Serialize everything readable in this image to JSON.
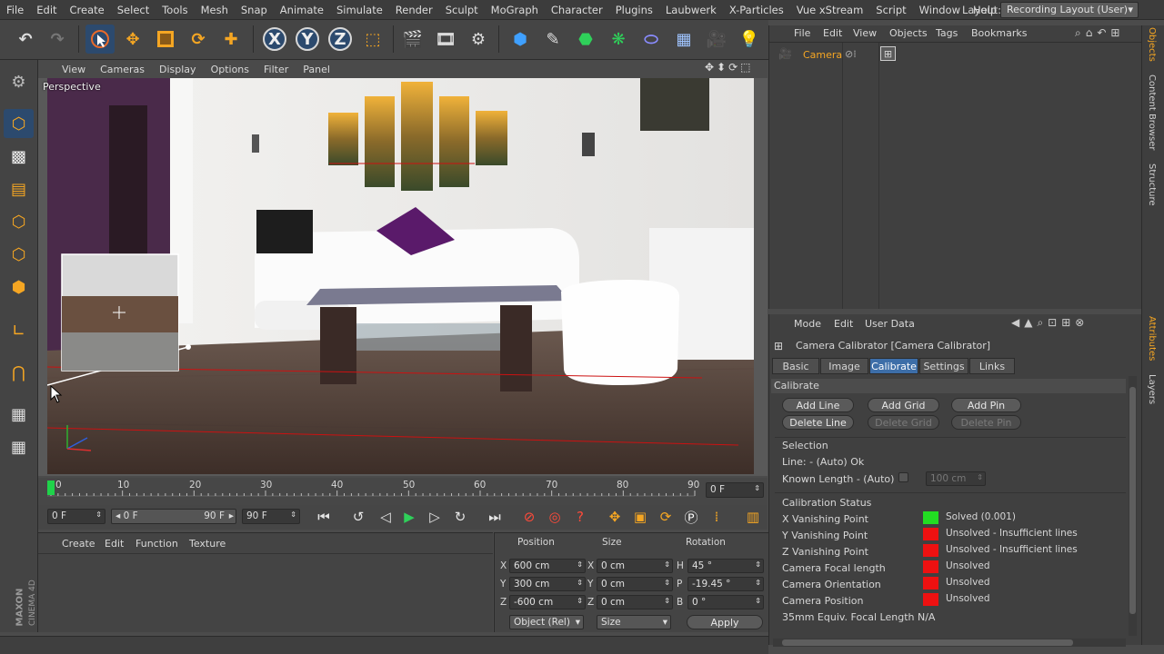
{
  "menu": [
    "File",
    "Edit",
    "Create",
    "Select",
    "Tools",
    "Mesh",
    "Snap",
    "Animate",
    "Simulate",
    "Render",
    "Sculpt",
    "MoGraph",
    "Character",
    "Plugins",
    "Laubwerk",
    "X-Particles",
    "Vue xStream",
    "Script",
    "Window",
    "Help"
  ],
  "layout": {
    "label": "Layout:",
    "value": "Recording Layout (User)"
  },
  "toolbar": {
    "x_label": "X",
    "y_label": "Y",
    "z_label": "Z"
  },
  "viewport": {
    "menu": [
      "View",
      "Cameras",
      "Display",
      "Options",
      "Filter",
      "Panel"
    ],
    "name": "Perspective"
  },
  "timeline": {
    "ticks": [
      "0",
      "10",
      "20",
      "30",
      "40",
      "50",
      "60",
      "70",
      "80",
      "90"
    ],
    "frame_field": "0 F"
  },
  "transport": {
    "start": "0 F",
    "range_start": "0 F",
    "range_end": "90 F",
    "end": "90 F"
  },
  "material_manager": {
    "menu": [
      "Create",
      "Edit",
      "Function",
      "Texture"
    ]
  },
  "coords": {
    "headers": [
      "Position",
      "Size",
      "Rotation"
    ],
    "rows": [
      {
        "axis": "X",
        "pos": "600 cm",
        "saxis": "X",
        "size": "0 cm",
        "raxis": "H",
        "rot": "45 °"
      },
      {
        "axis": "Y",
        "pos": "300 cm",
        "saxis": "Y",
        "size": "0 cm",
        "raxis": "P",
        "rot": "-19.45 °"
      },
      {
        "axis": "Z",
        "pos": "-600 cm",
        "saxis": "Z",
        "size": "0 cm",
        "raxis": "B",
        "rot": "0 °"
      }
    ],
    "mode": "Object (Rel)",
    "size_mode": "Size",
    "apply": "Apply"
  },
  "object_manager": {
    "menu": [
      "File",
      "Edit",
      "View",
      "Objects",
      "Tags",
      "Bookmarks"
    ],
    "object": "Camera"
  },
  "attributes": {
    "menu": [
      "Mode",
      "Edit",
      "User Data"
    ],
    "title": "Camera Calibrator [Camera Calibrator]",
    "tabs": [
      "Basic",
      "Image",
      "Calibrate",
      "Settings",
      "Links"
    ],
    "section": "Calibrate",
    "buttons": [
      "Add Line",
      "Add Grid",
      "Add Pin",
      "Delete Line",
      "Delete Grid",
      "Delete Pin"
    ],
    "selection_title": "Selection",
    "line_status": "Line: - (Auto) Ok",
    "known_length_label": "Known Length - (Auto)",
    "known_length_value": "100 cm",
    "status_title": "Calibration Status",
    "status": [
      {
        "label": "X Vanishing Point",
        "value": "Solved (0.001)",
        "color": "#22dd22"
      },
      {
        "label": "Y Vanishing Point",
        "value": "Unsolved - Insufficient lines",
        "color": "#ee1111"
      },
      {
        "label": "Z Vanishing Point",
        "value": "Unsolved - Insufficient lines",
        "color": "#ee1111"
      },
      {
        "label": "Camera Focal length",
        "value": "Unsolved",
        "color": "#ee1111"
      },
      {
        "label": "Camera Orientation",
        "value": "Unsolved",
        "color": "#ee1111"
      },
      {
        "label": "Camera Position",
        "value": "Unsolved",
        "color": "#ee1111"
      }
    ],
    "focal_equiv": "35mm Equiv. Focal Length N/A"
  },
  "side_tabs": {
    "objects": "Objects",
    "content_browser": "Content Browser",
    "structure": "Structure",
    "attributes": "Attributes",
    "layers": "Layers"
  },
  "brand": {
    "maxon": "MAXON",
    "cinema": "CINEMA 4D"
  }
}
